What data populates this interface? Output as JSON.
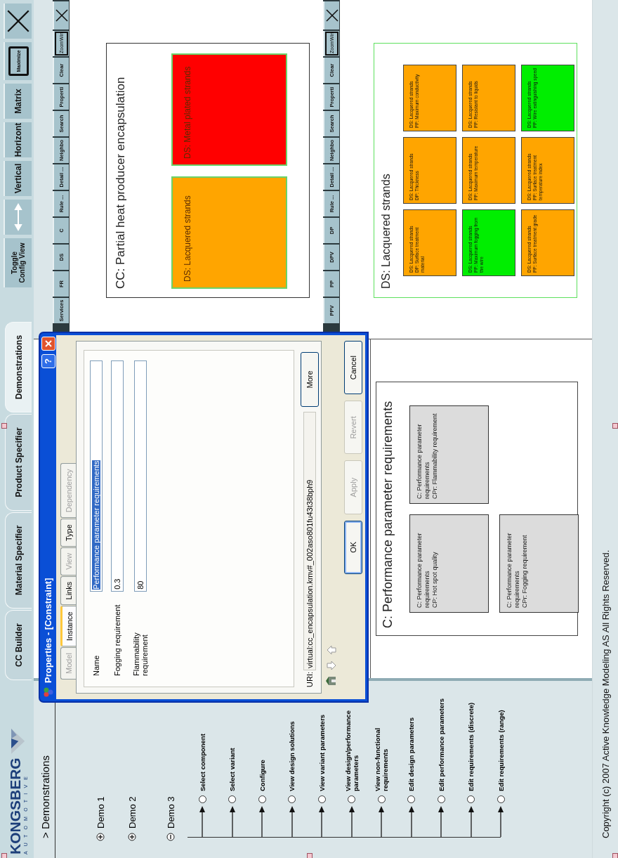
{
  "header": {
    "logo": {
      "brand": "KONGSBERG",
      "division": "AUTOMOTIVE"
    },
    "tabs": [
      {
        "label": "CC Builder",
        "selected": false
      },
      {
        "label": "Material Specifier",
        "selected": false
      },
      {
        "label": "Product Specifier",
        "selected": false
      },
      {
        "label": "Demonstrations",
        "selected": true
      }
    ],
    "tools": [
      {
        "kind": "text",
        "label": "Toggle Config View"
      },
      {
        "kind": "arrows"
      },
      {
        "kind": "text",
        "label": "Vertical"
      },
      {
        "kind": "text",
        "label": "Horizont"
      },
      {
        "kind": "text",
        "label": "Matrix"
      },
      {
        "kind": "boxed",
        "label": "Maximize"
      },
      {
        "kind": "close"
      }
    ]
  },
  "sidebar": {
    "title": "> Demonstrations",
    "demos": [
      {
        "label": "Demo 1",
        "expanded": false
      },
      {
        "label": "Demo 2",
        "expanded": false
      },
      {
        "label": "Demo 3",
        "expanded": true,
        "children": [
          {
            "label": "Select component",
            "selected": false
          },
          {
            "label": "Select variant",
            "selected": false
          },
          {
            "label": "Configure",
            "selected": false
          },
          {
            "label": "View design solutions",
            "selected": false
          },
          {
            "label": "View variant parameters",
            "selected": false
          },
          {
            "label": "View design/performance parameters",
            "selected": false
          },
          {
            "label": "View non-functional requirements",
            "selected": false
          },
          {
            "label": "Edit design parameters",
            "selected": false
          },
          {
            "label": "Edit performance parameters",
            "selected": false
          },
          {
            "label": "Edit requirements (discrete)",
            "selected": false
          },
          {
            "label": "Edit requirements (range)",
            "selected": false
          }
        ]
      }
    ]
  },
  "panes": [
    {
      "toolbar": [
        {
          "kind": "text",
          "label": "Services"
        },
        {
          "kind": "text",
          "label": "FR"
        },
        {
          "kind": "text",
          "label": "DS"
        },
        {
          "kind": "text",
          "label": "C"
        },
        {
          "kind": "text",
          "label": "Rule ..."
        },
        {
          "kind": "text",
          "label": "Detail ..."
        },
        {
          "kind": "text",
          "label": "Neighbo"
        },
        {
          "kind": "text",
          "label": "Search"
        },
        {
          "kind": "text",
          "label": "Properti"
        },
        {
          "kind": "text",
          "label": "Clear"
        },
        {
          "kind": "boxed",
          "label": "ZoomWin"
        },
        {
          "kind": "close"
        }
      ],
      "diagram": {
        "title": "CC: Partial heat producer encapsulation",
        "kind": "row",
        "items": [
          {
            "lines": [
              "DS: Lacquered strands"
            ],
            "color": "#ffa500"
          },
          {
            "lines": [
              "DS: Metal plated strands"
            ],
            "color": "#ff0000"
          }
        ]
      }
    },
    {
      "toolbar": [
        {
          "kind": "text",
          "label": "PPV"
        },
        {
          "kind": "text",
          "label": "PP"
        },
        {
          "kind": "text",
          "label": "DPV"
        },
        {
          "kind": "text",
          "label": "DP"
        },
        {
          "kind": "text",
          "label": "Rule ..."
        },
        {
          "kind": "text",
          "label": "Detail ..."
        },
        {
          "kind": "text",
          "label": "Neighbo"
        },
        {
          "kind": "text",
          "label": "Search"
        },
        {
          "kind": "text",
          "label": "Properti"
        },
        {
          "kind": "text",
          "label": "Clear"
        },
        {
          "kind": "boxed",
          "label": "ZoomWin"
        },
        {
          "kind": "close"
        }
      ],
      "diagram": {
        "title": "DS: Lacquered strands",
        "kind": "grid",
        "items": [
          {
            "lines": [
              "DS: Lacquered strands",
              "DP: Surface treatment material"
            ],
            "color": "#ffa500"
          },
          {
            "lines": [
              "DS: Lacquered strands",
              "DP: Thickness"
            ],
            "color": "#ffa500"
          },
          {
            "lines": [
              "DS: Lacquered strands",
              "PP: Maximum conductivity"
            ],
            "color": "#ffa500"
          },
          {
            "lines": [
              "DS: Lacquered strands",
              "PP: Maximum fogging from the wire"
            ],
            "color": "#00ee00"
          },
          {
            "lines": [
              "DS: Lacquered strands",
              "PP: Maximum temperature"
            ],
            "color": "#ffa500"
          },
          {
            "lines": [
              "DS: Lacquered strands",
              "PP: Resistant to liquids"
            ],
            "color": "#ffa500"
          },
          {
            "lines": [
              "DS: Lacquered strands",
              "PP: Surface treatment grade"
            ],
            "color": "#ffa500"
          },
          {
            "lines": [
              "DS: Lacquered strands",
              "PP: Surface treatment temperature index"
            ],
            "color": "#ffa500"
          },
          {
            "lines": [
              "DS: Lacquered strands",
              "PP: Wire extinguishing speed"
            ],
            "color": "#00ee00"
          }
        ]
      }
    }
  ],
  "constraint_view": {
    "title": "C: Performance parameter requirements",
    "items": [
      {
        "lines": [
          "C: Performance parameter requirements",
          "CP: Hot spot quality"
        ]
      },
      {
        "lines": [
          "C: Performance parameter requirements",
          "CPr: Flammability requirement"
        ]
      },
      {
        "lines": [
          "C: Performance parameter requirements",
          "CPr: Fogging requirement"
        ]
      }
    ]
  },
  "dialog": {
    "title": "Properties - [Constraint]",
    "help": "?",
    "tabs": [
      {
        "label": "Model",
        "selected": false,
        "disabled": true
      },
      {
        "label": "Instance",
        "selected": true,
        "disabled": false
      },
      {
        "label": "Links",
        "selected": false,
        "disabled": false
      },
      {
        "label": "View",
        "selected": false,
        "disabled": true
      },
      {
        "label": "Type",
        "selected": false,
        "disabled": false
      },
      {
        "label": "Dependency",
        "selected": false,
        "disabled": true
      }
    ],
    "fields": [
      {
        "label": "Name",
        "value": "Performance parameter requirements",
        "highlighted": true
      },
      {
        "label": "Fogging requirement",
        "value": "0.3",
        "highlighted": false
      },
      {
        "label": "Flammability requirement",
        "value": "80",
        "highlighted": false
      }
    ],
    "uri_label": "URI:",
    "uri": "virtual:cc_encapsulation.kmv#_002aso801fu43t38bph9",
    "more": "More",
    "buttons": [
      {
        "label": "OK",
        "default": true,
        "disabled": false
      },
      {
        "label": "Apply",
        "default": false,
        "disabled": true
      },
      {
        "label": "Revert",
        "default": false,
        "disabled": true
      },
      {
        "label": "Cancel",
        "default": false,
        "disabled": false
      }
    ]
  },
  "footer": {
    "copyright": "Copyright (c) 2007 Active Knowledge Modeling AS All Rights Reserved."
  }
}
